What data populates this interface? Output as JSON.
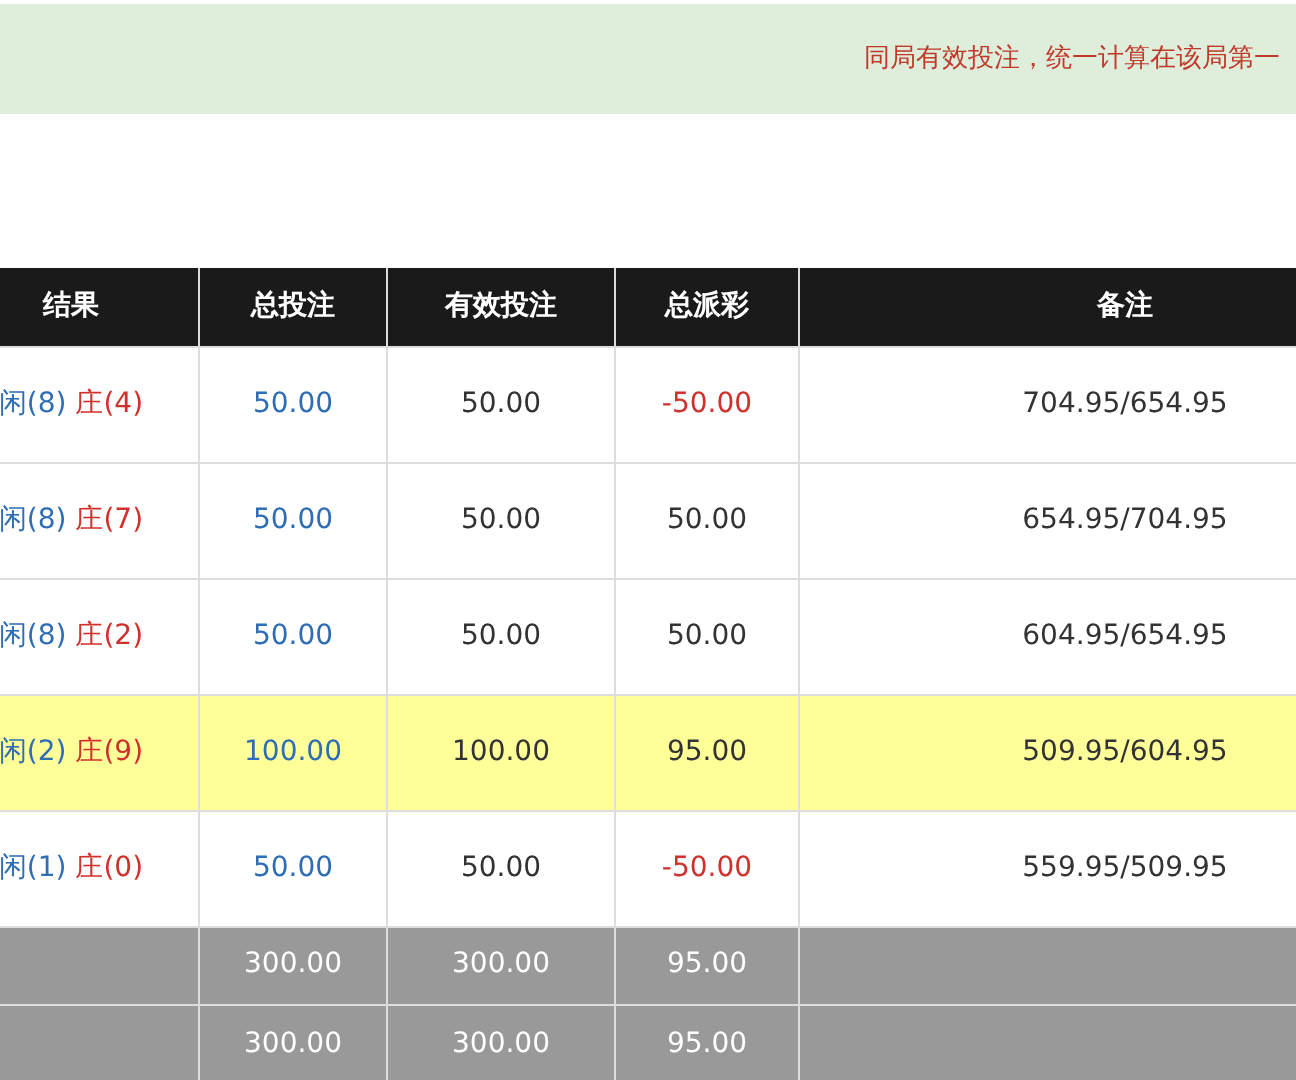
{
  "notice": "同局有效投注，统一计算在该局第一",
  "table": {
    "columns": [
      "结果",
      "总投注",
      "有效投注",
      "总派彩",
      "备注"
    ],
    "rows": [
      {
        "player": "闲(8)",
        "banker": "庄(4)",
        "total_bet": "50.00",
        "valid_bet": "50.00",
        "payout": "-50.00",
        "loss": true,
        "note": "704.95/654.95",
        "highlighted": false
      },
      {
        "player": "闲(8)",
        "banker": "庄(7)",
        "total_bet": "50.00",
        "valid_bet": "50.00",
        "payout": "50.00",
        "loss": false,
        "note": "654.95/704.95",
        "highlighted": false
      },
      {
        "player": "闲(8)",
        "banker": "庄(2)",
        "total_bet": "50.00",
        "valid_bet": "50.00",
        "payout": "50.00",
        "loss": false,
        "note": "604.95/654.95",
        "highlighted": false
      },
      {
        "player": "闲(2)",
        "banker": "庄(9)",
        "total_bet": "100.00",
        "valid_bet": "100.00",
        "payout": "95.00",
        "loss": false,
        "note": "509.95/604.95",
        "highlighted": true
      },
      {
        "player": "闲(1)",
        "banker": "庄(0)",
        "total_bet": "50.00",
        "valid_bet": "50.00",
        "payout": "-50.00",
        "loss": true,
        "note": "559.95/509.95",
        "highlighted": false
      }
    ],
    "summary_rows": [
      {
        "total_bet": "300.00",
        "valid_bet": "300.00",
        "payout": "95.00"
      },
      {
        "total_bet": "300.00",
        "valid_bet": "300.00",
        "payout": "95.00"
      }
    ]
  }
}
